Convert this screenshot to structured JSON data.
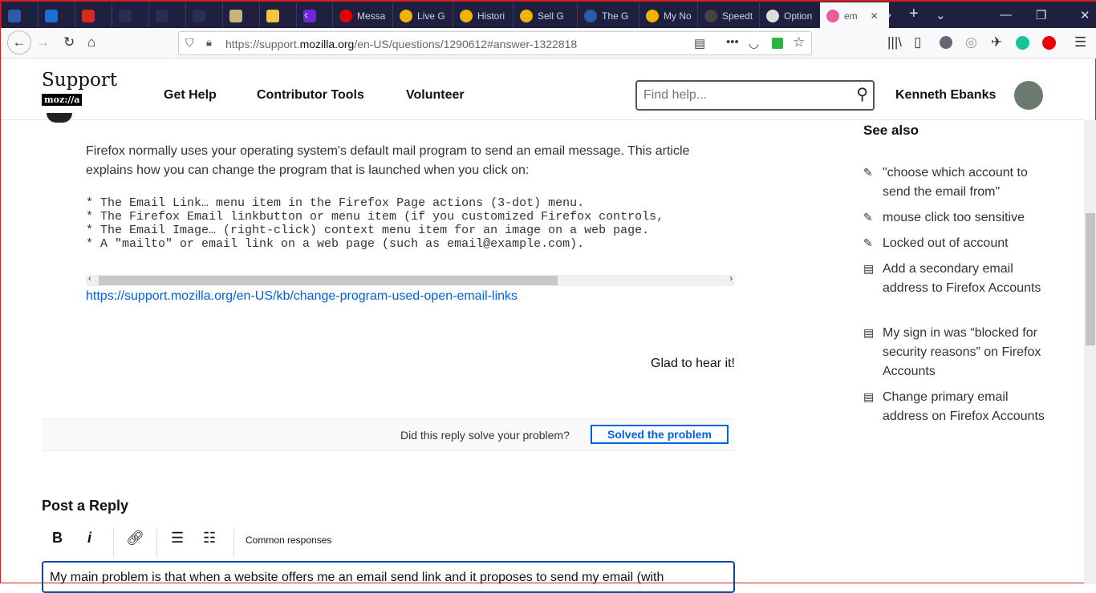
{
  "browser": {
    "tabs": [
      {
        "label": "",
        "color": "#2a5caa"
      },
      {
        "label": "",
        "color": "#1f6fd1"
      },
      {
        "label": "",
        "color": "#d52b1e"
      },
      {
        "label": "",
        "color": "#2a2c55"
      },
      {
        "label": "",
        "color": "#2a2c55"
      },
      {
        "label": "",
        "color": "#2a2c55"
      },
      {
        "label": "",
        "color": "#c9b37a"
      },
      {
        "label": "",
        "color": "#f6c343"
      },
      {
        "label": "",
        "color": "#6b2ad6"
      },
      {
        "label": "Messa",
        "color": "#e60000"
      },
      {
        "label": "Live G",
        "color": "#f0b400"
      },
      {
        "label": "Histori",
        "color": "#f0b400"
      },
      {
        "label": "Sell G",
        "color": "#f0b400"
      },
      {
        "label": "The G",
        "color": "#2a5caa"
      },
      {
        "label": "My No",
        "color": "#f0b400"
      },
      {
        "label": "Speedt",
        "color": "#444"
      },
      {
        "label": "Option",
        "color": "#ddd"
      },
      {
        "label": "em",
        "color": "#e85d9a"
      }
    ],
    "url_prefix": "https://support.",
    "url_domain": "mozilla.org",
    "url_path": "/en-US/questions/1290612#answer-1322818"
  },
  "header": {
    "logo_top": "Support",
    "logo_bottom": "moz://a",
    "nav": [
      "Get Help",
      "Contributor Tools",
      "Volunteer"
    ],
    "search_placeholder": "Find help...",
    "user": "Kenneth Ebanks"
  },
  "answer": {
    "intro": "Firefox normally uses your operating system's default mail program to send an email message. This article explains how you can change the program that is launched when you click on:",
    "code": [
      "* The Email Link… menu item in the Firefox Page actions (3-dot) menu.",
      "* The Firefox Email linkbutton or menu item (if you customized Firefox controls,",
      "* The Email Image… (right-click) context menu item for an image on a web page.",
      "* A \"mailto\" or email link on a web page (such as email@example.com)."
    ],
    "link": "https://support.mozilla.org/en-US/kb/change-program-used-open-email-links",
    "glad": "Glad to hear it!",
    "solved_question": "Did this reply solve your problem?",
    "solved_button": "Solved the problem"
  },
  "reply": {
    "title": "Post a Reply",
    "bold": "B",
    "italic": "i",
    "common": "Common responses",
    "text": "My main problem is that when a website offers me an email send link and it proposes to send my email (with"
  },
  "sidebar": {
    "title": "See also",
    "items": [
      {
        "label": "\"choose which account to send the email from\"",
        "icon": "question-edit-icon"
      },
      {
        "label": "mouse click too sensitive",
        "icon": "question-edit-icon"
      },
      {
        "label": "Locked out of account",
        "icon": "question-edit-icon"
      },
      {
        "label": "Add a secondary email address to Firefox Accounts",
        "icon": "article-icon"
      },
      {
        "label": "My sign in was “blocked for security reasons” on Firefox Accounts",
        "icon": "article-icon"
      },
      {
        "label": "Change primary email address on Firefox Accounts",
        "icon": "article-icon"
      }
    ]
  }
}
